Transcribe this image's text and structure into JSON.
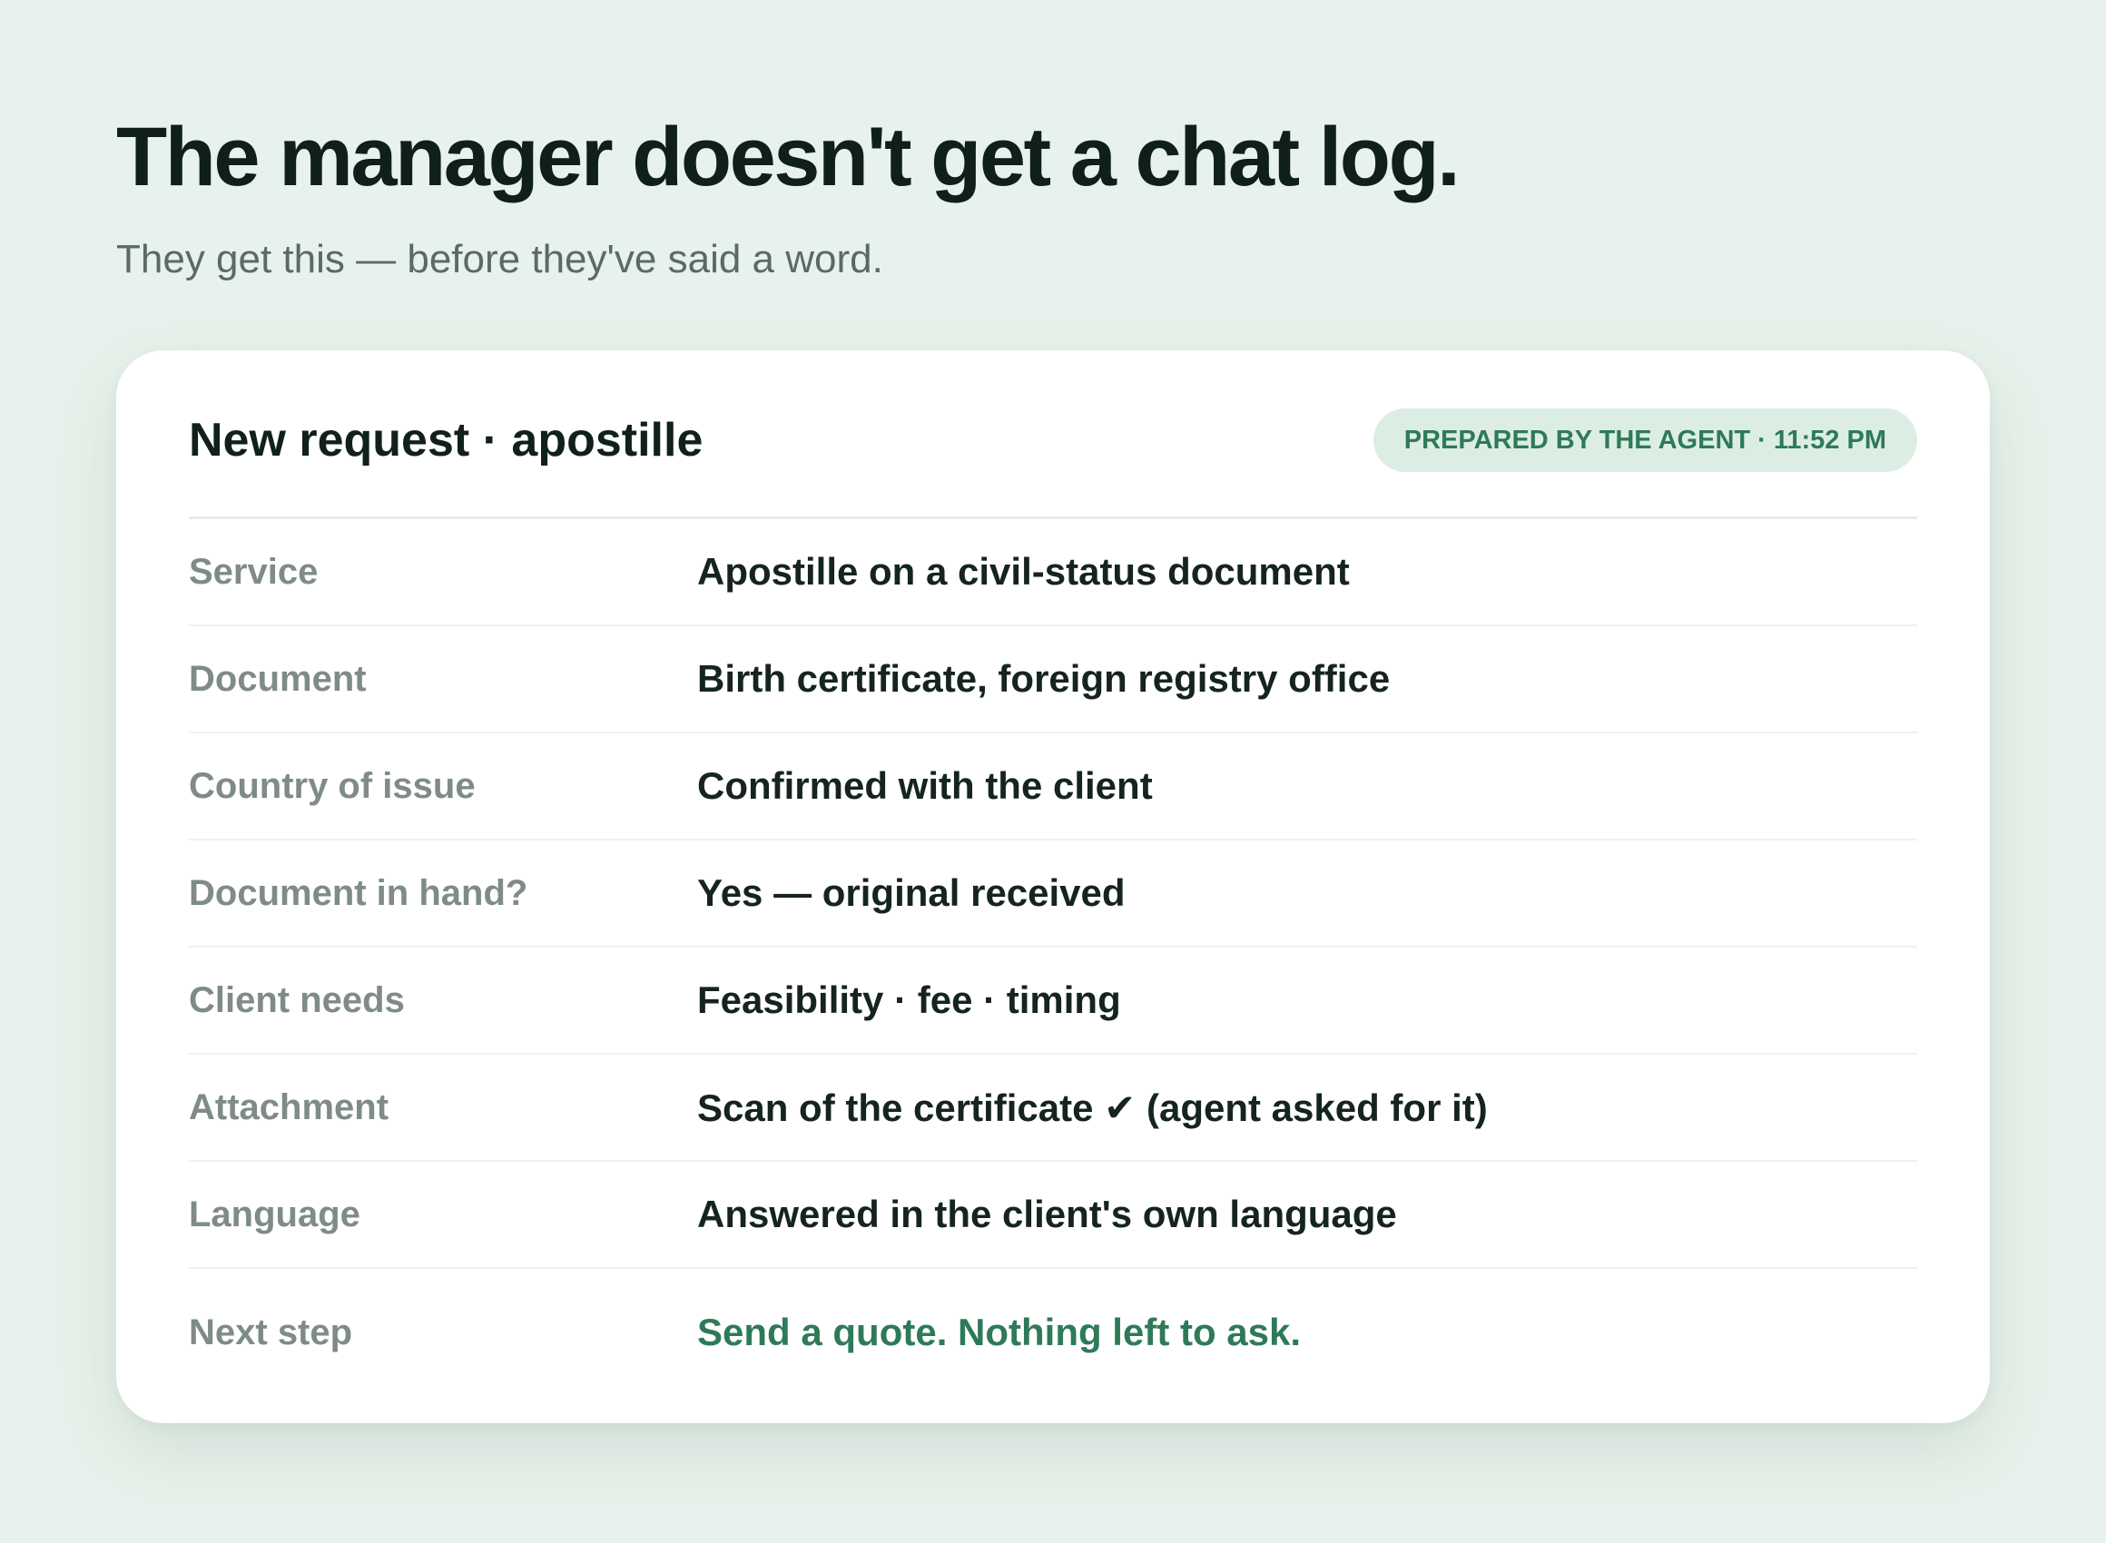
{
  "hero": {
    "title": "The manager doesn't get a chat log.",
    "subtitle": "They get this — before they've said a word."
  },
  "card": {
    "title": "New request · apostille",
    "badge": "PREPARED BY THE AGENT · 11:52 PM",
    "accent_color": "#2e7a58",
    "rows": [
      {
        "label": "Service",
        "value": "Apostille on a civil-status document"
      },
      {
        "label": "Document",
        "value": "Birth certificate, foreign registry office"
      },
      {
        "label": "Country of issue",
        "value": "Confirmed with the client"
      },
      {
        "label": "Document in hand?",
        "value": "Yes — original received"
      },
      {
        "label": "Client needs",
        "value": "Feasibility · fee · timing"
      },
      {
        "label": "Attachment",
        "value": "Scan of the certificate ✔ (agent asked for it)"
      },
      {
        "label": "Language",
        "value": "Answered in the client's own language"
      },
      {
        "label": "Next step",
        "value": "Send a quote. Nothing left to ask."
      }
    ]
  }
}
